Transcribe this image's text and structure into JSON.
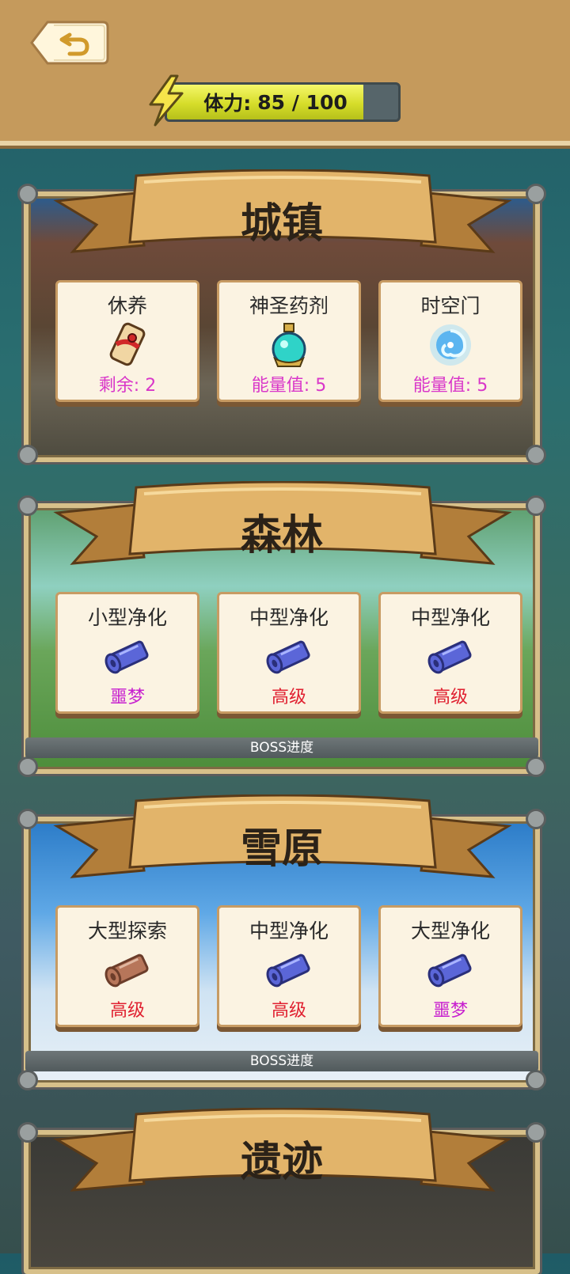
{
  "header": {
    "energy_label": "体力:",
    "energy_value": "85 / 100",
    "energy_current": 85,
    "energy_max": 100
  },
  "regions": [
    {
      "title": "城镇",
      "cards": [
        {
          "title": "休养",
          "icon": "scroll-tied-icon",
          "sub": "剩余: 2",
          "sub_color": "#d936c9"
        },
        {
          "title": "神圣药剂",
          "icon": "potion-icon",
          "sub": "能量值: 5",
          "sub_color": "#d936c9"
        },
        {
          "title": "时空门",
          "icon": "portal-icon",
          "sub": "能量值: 5",
          "sub_color": "#d936c9"
        }
      ]
    },
    {
      "title": "森林",
      "cards": [
        {
          "title": "小型净化",
          "icon": "blue-scroll-icon",
          "sub": "噩梦",
          "sub_color": "#c71fcf"
        },
        {
          "title": "中型净化",
          "icon": "blue-scroll-icon",
          "sub": "高级",
          "sub_color": "#e02030"
        },
        {
          "title": "中型净化",
          "icon": "blue-scroll-icon",
          "sub": "高级",
          "sub_color": "#e02030"
        }
      ],
      "boss_label": "BOSS进度"
    },
    {
      "title": "雪原",
      "cards": [
        {
          "title": "大型探索",
          "icon": "brown-scroll-icon",
          "sub": "高级",
          "sub_color": "#e02030"
        },
        {
          "title": "中型净化",
          "icon": "blue-scroll-icon",
          "sub": "高级",
          "sub_color": "#e02030"
        },
        {
          "title": "大型净化",
          "icon": "blue-scroll-icon",
          "sub": "噩梦",
          "sub_color": "#c71fcf"
        }
      ],
      "boss_label": "BOSS进度"
    },
    {
      "title": "遗迹"
    }
  ]
}
